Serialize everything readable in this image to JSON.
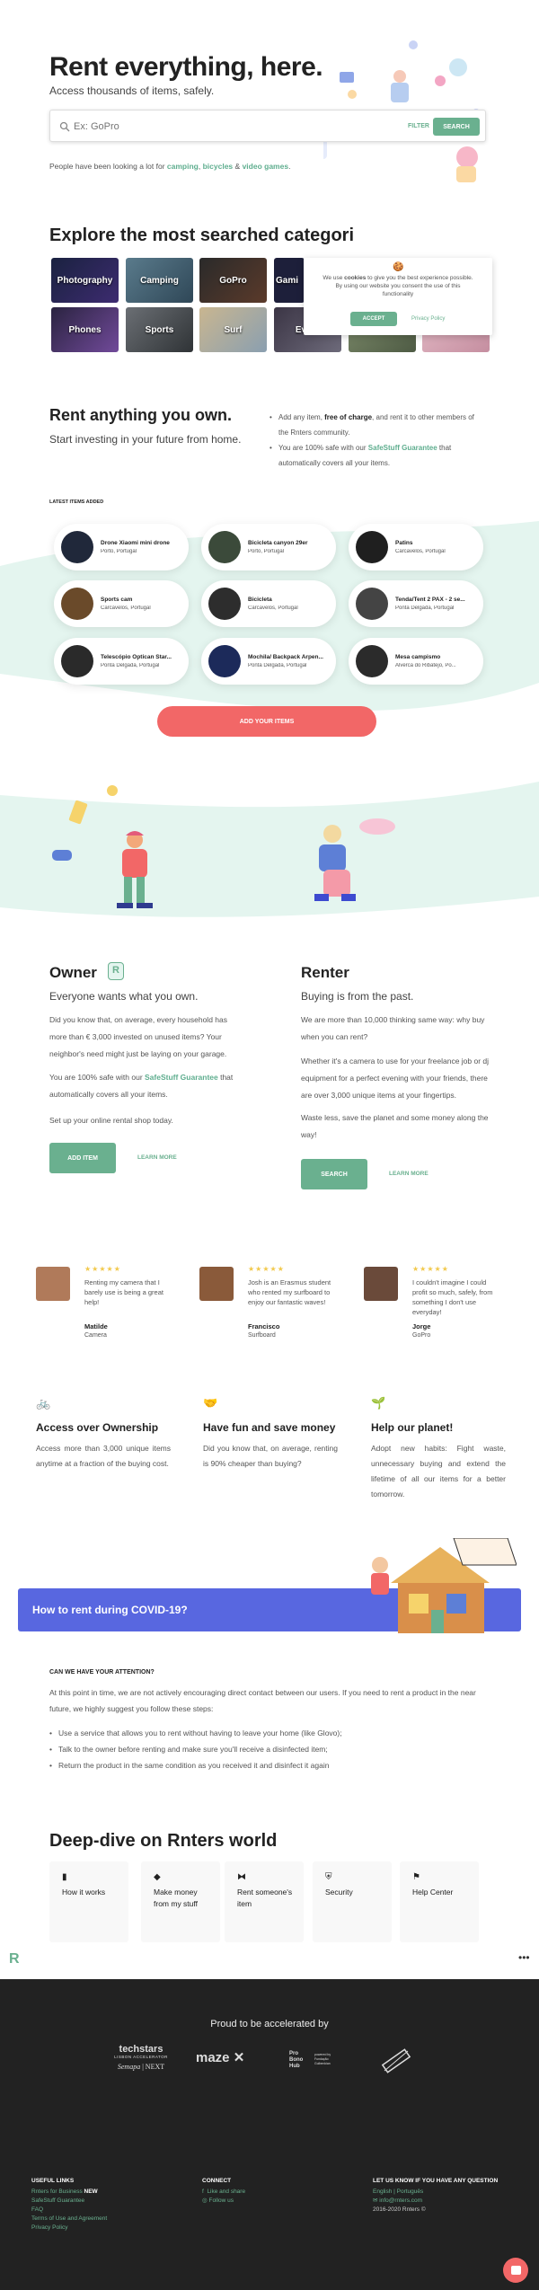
{
  "hero": {
    "title": "Rent everything, here.",
    "subtitle": "Access thousands of items, safely.",
    "search_placeholder": "Ex: GoPro",
    "filter_label": "FILTER",
    "search_label": "SEARCH",
    "looking_prefix": "People have been looking a lot for ",
    "looking_1": "camping",
    "looking_sep": ", ",
    "looking_2": "bicycles",
    "looking_and": " & ",
    "looking_3": "video games",
    "looking_end": "."
  },
  "explore": {
    "title": "Explore the most searched categori",
    "categories": [
      "Photography",
      "Camping",
      "GoPro",
      "Gami",
      "Phones",
      "Sports",
      "Surf",
      "Event",
      "",
      ""
    ]
  },
  "cookie": {
    "icon": "🍪",
    "text_pre": "We use ",
    "text_bold": "cookies",
    "text_post": " to give you the best experience possible. By using our website you consent the use of this functionality",
    "accept": "ACCEPT",
    "policy": "Privacy Policy"
  },
  "rent_anything": {
    "title": "Rent anything you own.",
    "subtitle": "Start investing in your future from home.",
    "b1_pre": "Add any item, ",
    "b1_bold": "free of charge",
    "b1_post": ", and rent it to other members of the Rnters community.",
    "b2_pre": "You are 100% safe with our ",
    "b2_link": "SafeStuff Guarantee",
    "b2_post": " that automatically covers all your items."
  },
  "latest": {
    "label": "LATEST ITEMS ADDED",
    "items": [
      {
        "name": "Drone Xiaomi mini drone",
        "loc": "Porto, Portugal"
      },
      {
        "name": "Bicicleta canyon 29er",
        "loc": "Porto, Portugal"
      },
      {
        "name": "Patins",
        "loc": "Carcavelos, Portugal"
      },
      {
        "name": "Sports cam",
        "loc": "Carcavelos, Portugal"
      },
      {
        "name": "Bicicleta",
        "loc": "Carcavelos, Portugal"
      },
      {
        "name": "Tenda/Tent 2 PAX - 2 se...",
        "loc": "Ponta Delgada, Portugal"
      },
      {
        "name": "Telescópio Optican Star...",
        "loc": "Ponta Delgada, Portugal"
      },
      {
        "name": "Mochila/ Backpack Arpen...",
        "loc": "Ponta Delgada, Portugal"
      },
      {
        "name": "Mesa campismo",
        "loc": "Alverca do Ribatejo, Po..."
      }
    ],
    "add_button": "ADD YOUR ITEMS"
  },
  "owner": {
    "title": "Owner",
    "subtitle": "Everyone wants what you own.",
    "p1": "Did you know that, on average, every household has more than € 3,000 invested on unused items? Your neighbor's need might just be laying on your garage.",
    "p2_pre": "You are 100% safe with our ",
    "p2_link": "SafeStuff Guarantee",
    "p2_post": " that automatically covers all your items.",
    "p3": "Set up your online rental shop today.",
    "add_btn": "ADD ITEM",
    "learn": "LEARN MORE"
  },
  "renter": {
    "title": "Renter",
    "subtitle": "Buying is from the past.",
    "p1": "We are more than 10,000 thinking same way: why buy when you can rent?",
    "p2": "Whether it's a camera to use for your freelance job or dj equipment for a perfect evening with your friends, there are over 3,000 unique items at your fingertips.",
    "p3": "Waste less, save the planet and some money along the way!",
    "search_btn": "SEARCH",
    "learn": "LEARN MORE"
  },
  "testimonials": [
    {
      "stars": "★★★★★",
      "text": "Renting my camera that I barely use is being a great help!",
      "name": "Matilde",
      "role": "Camera"
    },
    {
      "stars": "★★★★★",
      "text": "Josh is an Erasmus student who rented my surfboard to enjoy our fantastic waves!",
      "name": "Francisco",
      "role": "Surfboard"
    },
    {
      "stars": "★★★★★",
      "text": "I couldn't imagine I could profit so much, safely, from something I don't use everyday!",
      "name": "Jorge",
      "role": "GoPro"
    }
  ],
  "features": [
    {
      "icon": "bicycle-icon",
      "title": "Access over Ownership",
      "text": "Access more than 3,000 unique items anytime at a fraction of the buying cost."
    },
    {
      "icon": "handshake-icon",
      "title": "Have fun and save money",
      "text": "Did you know that, on average, renting is 90% cheaper than buying?"
    },
    {
      "icon": "plant-icon",
      "title": "Help our planet!",
      "text": "Adopt new habits: Fight waste, unnecessary buying and extend the lifetime of all our items for a better tomorrow."
    }
  ],
  "covid": {
    "banner": "How to rent during COVID-19?",
    "heading": "CAN WE HAVE YOUR ATTENTION?",
    "intro": "At this point in time, we are not actively encouraging direct contact between our users. If you need to rent a product in the near future, we highly suggest you follow these steps:",
    "steps": [
      "Use a service that allows you to rent without having to leave your home (like Glovo);",
      "Talk to the owner before renting and make sure you'll receive a disinfected item;",
      "Return the product in the same condition as you received it and disinfect it again"
    ]
  },
  "deep": {
    "title": "Deep-dive on Rnters world",
    "cards": [
      {
        "icon": "book-icon",
        "label": "How it works"
      },
      {
        "icon": "tag-icon",
        "label": "Make money from my stuff"
      },
      {
        "icon": "handshake-icon",
        "label": "Rent someone's item"
      },
      {
        "icon": "shield-icon",
        "label": "Security"
      },
      {
        "icon": "flag-icon",
        "label": "Help Center"
      }
    ]
  },
  "footer": {
    "accelerated": "Proud to be accelerated by",
    "logos": {
      "techstars": "techstars",
      "lisbon": "LISBON ACCELERATOR",
      "semapa": "Semapa",
      "next": "NEXT",
      "maze": "maze",
      "pro": "Pro Bono Hub",
      "pro_sub": "powered by Fundação Gulbenkian"
    },
    "useful_title": "USEFUL LINKS",
    "useful": [
      "Rnters for Business",
      "SafeStuff Guarantee",
      "FAQ",
      "Terms of Use and Agreement",
      "Privacy Policy"
    ],
    "new_badge": "NEW",
    "connect_title": "CONNECT",
    "connect": [
      "Like and share",
      "Follow us"
    ],
    "question_title": "LET US KNOW IF YOU HAVE ANY QUESTION",
    "lang": "English | Português",
    "email": "info@rnters.com",
    "copyright": "2016-2020 Rnters ©"
  },
  "colors": {
    "green": "#6ab08f",
    "mint": "#e4f5ef",
    "coral": "#f26767",
    "covid_blue": "#5867e0",
    "footer_bg": "#222222"
  }
}
